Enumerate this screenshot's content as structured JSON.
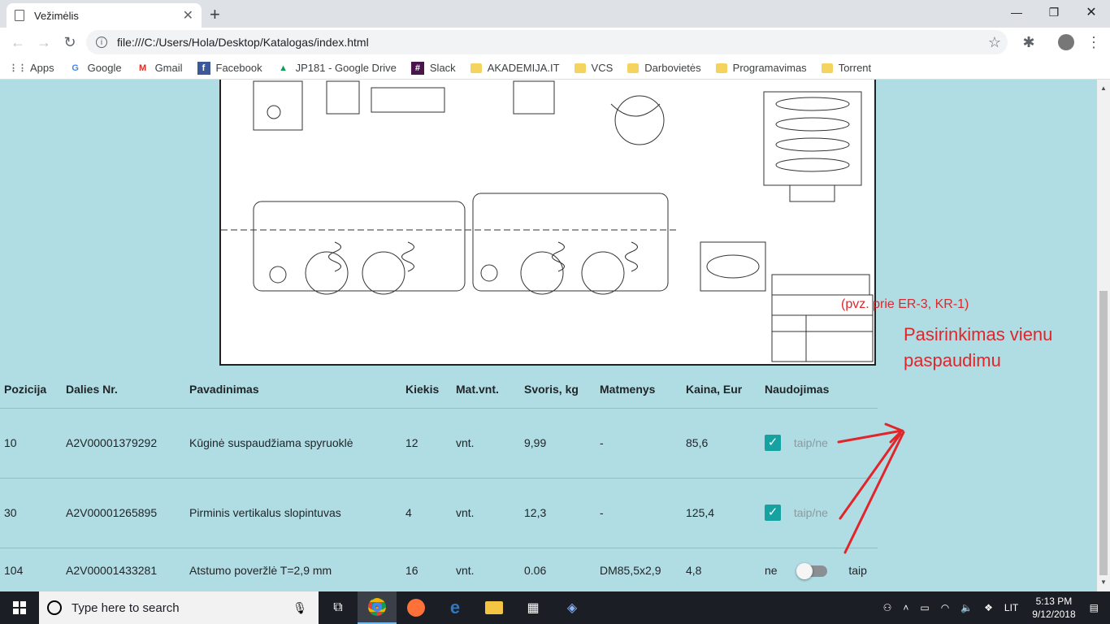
{
  "browser": {
    "tab_title": "Vežimėlis",
    "url": "file:///C:/Users/Hola/Desktop/Katalogas/index.html",
    "bookmarks": [
      {
        "label": "Apps",
        "icon": "apps-grid-icon"
      },
      {
        "label": "Google",
        "icon": "google-icon"
      },
      {
        "label": "Gmail",
        "icon": "gmail-icon"
      },
      {
        "label": "Facebook",
        "icon": "facebook-icon"
      },
      {
        "label": "JP181 - Google Drive",
        "icon": "drive-icon"
      },
      {
        "label": "Slack",
        "icon": "slack-icon"
      },
      {
        "label": "AKADEMIJA.IT",
        "icon": "folder-icon"
      },
      {
        "label": "VCS",
        "icon": "folder-icon"
      },
      {
        "label": "Darbovietės",
        "icon": "folder-icon"
      },
      {
        "label": "Programavimas",
        "icon": "folder-icon"
      },
      {
        "label": "Torrent",
        "icon": "folder-icon"
      }
    ]
  },
  "table": {
    "headers": [
      "Pozicija",
      "Dalies Nr.",
      "Pavadinimas",
      "Kiekis",
      "Mat.vnt.",
      "Svoris, kg",
      "Matmenys",
      "Kaina, Eur",
      "Naudojimas"
    ],
    "rows": [
      {
        "pozicija": "10",
        "dalies_nr": "A2V00001379292",
        "pavadinimas": "Kūginė suspaudžiama spyruoklė",
        "kiekis": "12",
        "mat_vnt": "vnt.",
        "svoris": "9,99",
        "matmenys": "-",
        "kaina": "85,6",
        "naudojimas_label": "taip/ne"
      },
      {
        "pozicija": "30",
        "dalies_nr": "A2V00001265895",
        "pavadinimas": "Pirminis vertikalus slopintuvas",
        "kiekis": "4",
        "mat_vnt": "vnt.",
        "svoris": "12,3",
        "matmenys": "-",
        "kaina": "125,4",
        "naudojimas_label": "taip/ne"
      },
      {
        "pozicija": "104",
        "dalies_nr": "A2V00001433281",
        "pavadinimas": "Atstumo poveržlė T=2,9 mm",
        "kiekis": "16",
        "mat_vnt": "vnt.",
        "svoris": "0.06",
        "matmenys": "DM85,5x2,9",
        "kaina": "4,8",
        "toggle_off": "ne",
        "toggle_on": "taip"
      }
    ]
  },
  "annotations": {
    "note_small": "(pvz. prie ER-3, KR-1)",
    "note_large": "Pasirinkimas vienu paspaudimu"
  },
  "taskbar": {
    "search_placeholder": "Type here to search",
    "language": "LIT",
    "time": "5:13 PM",
    "date": "9/12/2018"
  },
  "colors": {
    "page_bg": "#b0dde3",
    "checkbox": "#17a2a2",
    "annotation": "#e0262b"
  }
}
